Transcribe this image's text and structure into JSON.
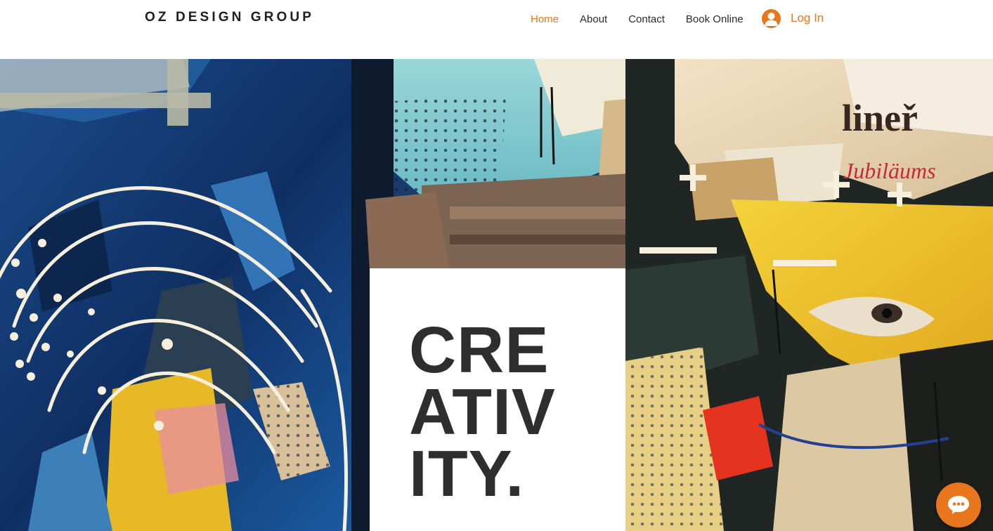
{
  "header": {
    "brand": "OZ DESIGN GROUP",
    "nav": [
      {
        "label": "Home",
        "active": true
      },
      {
        "label": "About",
        "active": false
      },
      {
        "label": "Contact",
        "active": false
      },
      {
        "label": "Book Online",
        "active": false
      }
    ],
    "login_label": "Log In"
  },
  "hero": {
    "headline_lines": [
      "CRE",
      "ATIV",
      "ITY."
    ]
  },
  "colors": {
    "accent": "#e8761c",
    "headline": "#2e2e2e",
    "nav_text": "#2b2b2b"
  },
  "icons": {
    "login": "user-avatar-icon",
    "chat": "chat-bubble-icon"
  }
}
